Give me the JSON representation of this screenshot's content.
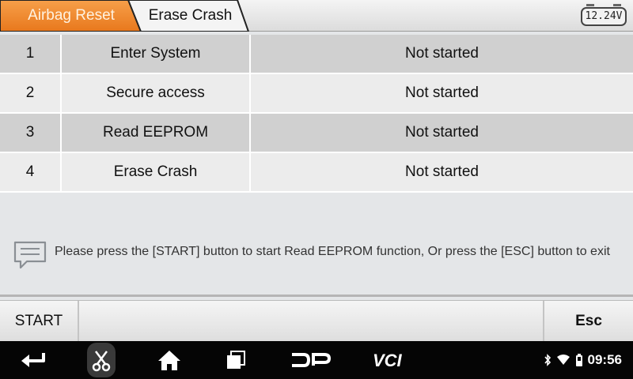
{
  "header": {
    "tabs": [
      {
        "label": "Airbag Reset",
        "active": true
      },
      {
        "label": "Erase Crash",
        "active": false
      }
    ],
    "voltage": "12.24V",
    "accent_color": "#f08a2c"
  },
  "table": {
    "rows": [
      {
        "num": "1",
        "step": "Enter System",
        "status": "Not started"
      },
      {
        "num": "2",
        "step": "Secure access",
        "status": "Not started"
      },
      {
        "num": "3",
        "step": "Read EEPROM",
        "status": "Not started"
      },
      {
        "num": "4",
        "step": "Erase Crash",
        "status": "Not started"
      }
    ]
  },
  "message": {
    "icon": "message-icon",
    "text": "Please press the [START] button to start Read EEPROM function, Or press the [ESC] button to exit"
  },
  "buttons": {
    "start": "START",
    "esc": "Esc"
  },
  "navbar": {
    "items": [
      "back-icon",
      "scissors-icon",
      "home-icon",
      "recent-apps-icon",
      "dp-logo-icon",
      "vci-logo-icon"
    ],
    "dp_label": "DP",
    "vci_label": "VCI",
    "status_icons": [
      "bluetooth-icon",
      "wifi-icon",
      "battery-icon"
    ],
    "time": "09:56"
  }
}
